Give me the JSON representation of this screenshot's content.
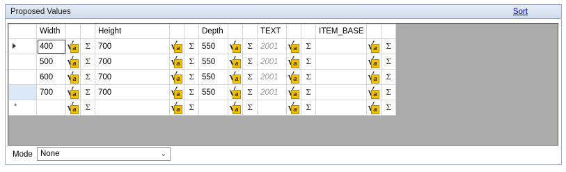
{
  "panel": {
    "title": "Proposed Values",
    "sort_label": "Sort"
  },
  "grid": {
    "columns": [
      "Width",
      "Height",
      "Depth",
      "TEXT",
      "ITEM_BASE"
    ],
    "rows": [
      {
        "indicator": "current",
        "width": "400",
        "height": "700",
        "depth": "550",
        "text": "2001",
        "item_base": ""
      },
      {
        "indicator": "",
        "width": "500",
        "height": "700",
        "depth": "550",
        "text": "2001",
        "item_base": ""
      },
      {
        "indicator": "",
        "width": "600",
        "height": "700",
        "depth": "550",
        "text": "2001",
        "item_base": ""
      },
      {
        "indicator": "selected",
        "width": "700",
        "height": "700",
        "depth": "550",
        "text": "2001",
        "item_base": ""
      },
      {
        "indicator": "new",
        "width": "",
        "height": "",
        "depth": "",
        "text": "",
        "item_base": ""
      }
    ],
    "formula_icon": "formula-sqrt-a-icon",
    "sum_icon": "sigma-icon",
    "new_row_glyph": "*"
  },
  "mode": {
    "label": "Mode",
    "value": "None"
  },
  "colors": {
    "accent": "#0000cc",
    "grid_bg": "#ababab",
    "header_grad": "#cfdcec",
    "selected_row": "#dbe8f7",
    "formula_yellow": "#f2c100"
  }
}
